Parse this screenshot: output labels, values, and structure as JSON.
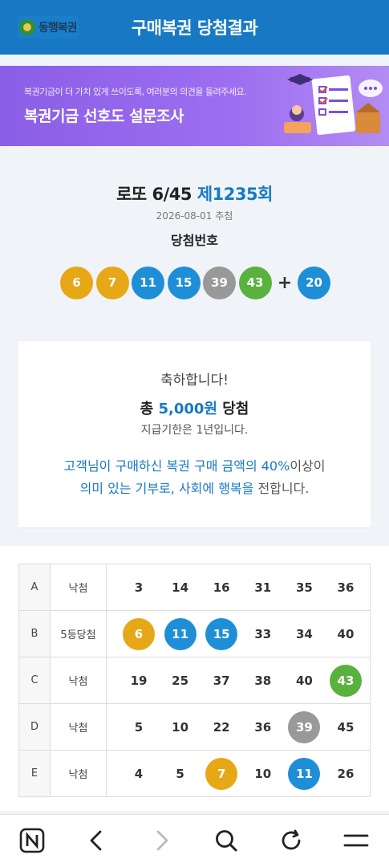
{
  "header": {
    "logo_text": "동행복권",
    "title": "구매복권 당첨결과"
  },
  "banner": {
    "subtitle": "복권기금이 더 가치 있게 쓰이도록, 여러분의 의견을 들려주세요.",
    "title": "복권기금 선호도 설문조사"
  },
  "result": {
    "game_name": "로또 6/45",
    "round": "제1235회",
    "draw_date": "2026-08-01 추첨",
    "win_label": "당첨번호",
    "winning_numbers": [
      {
        "num": "6",
        "color": "#e6a817"
      },
      {
        "num": "7",
        "color": "#e6a817"
      },
      {
        "num": "11",
        "color": "#1e8fd6"
      },
      {
        "num": "15",
        "color": "#1e8fd6"
      },
      {
        "num": "39",
        "color": "#999999"
      },
      {
        "num": "43",
        "color": "#5ab23e"
      }
    ],
    "plus": "+",
    "bonus": {
      "num": "20",
      "color": "#1e8fd6"
    }
  },
  "card": {
    "congrats": "축하합니다!",
    "prize_prefix": "총",
    "prize_amount": "5,000원",
    "prize_suffix": "당첨",
    "deadline": "지급기한은 1년입니다.",
    "donation_line1_hl": "고객님이 구매하신 복권 구매 금액의 40%",
    "donation_line1_rest": "이상이",
    "donation_line2_hl": "의미 있는 기부로, 사회에 행복을",
    "donation_line2_rest": " 전합니다."
  },
  "games": [
    {
      "label": "A",
      "status": "낙첨",
      "numbers": [
        {
          "n": "3"
        },
        {
          "n": "14"
        },
        {
          "n": "16"
        },
        {
          "n": "31"
        },
        {
          "n": "35"
        },
        {
          "n": "36"
        }
      ]
    },
    {
      "label": "B",
      "status": "5등당첨",
      "numbers": [
        {
          "n": "6",
          "color": "#e6a817"
        },
        {
          "n": "11",
          "color": "#1e8fd6"
        },
        {
          "n": "15",
          "color": "#1e8fd6"
        },
        {
          "n": "33"
        },
        {
          "n": "34"
        },
        {
          "n": "40"
        }
      ]
    },
    {
      "label": "C",
      "status": "낙첨",
      "numbers": [
        {
          "n": "19"
        },
        {
          "n": "25"
        },
        {
          "n": "37"
        },
        {
          "n": "38"
        },
        {
          "n": "40"
        },
        {
          "n": "43",
          "color": "#5ab23e"
        }
      ]
    },
    {
      "label": "D",
      "status": "낙첨",
      "numbers": [
        {
          "n": "5"
        },
        {
          "n": "10"
        },
        {
          "n": "22"
        },
        {
          "n": "36"
        },
        {
          "n": "39",
          "color": "#999999"
        },
        {
          "n": "45"
        }
      ]
    },
    {
      "label": "E",
      "status": "낙첨",
      "numbers": [
        {
          "n": "4"
        },
        {
          "n": "5"
        },
        {
          "n": "7",
          "color": "#e6a817"
        },
        {
          "n": "10"
        },
        {
          "n": "11",
          "color": "#1e8fd6"
        },
        {
          "n": "26"
        }
      ]
    }
  ],
  "bottom_bar": {
    "icons": [
      "naver-home-icon",
      "back-icon",
      "forward-icon",
      "search-icon",
      "refresh-icon",
      "menu-icon"
    ]
  }
}
